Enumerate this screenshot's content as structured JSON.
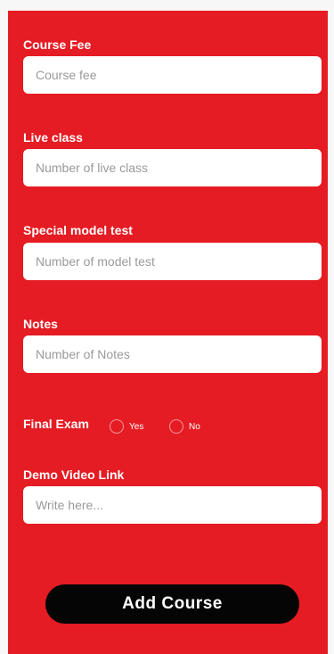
{
  "form": {
    "course_fee": {
      "label": "Course Fee",
      "placeholder": "Course fee",
      "value": ""
    },
    "live_class": {
      "label": "Live class",
      "placeholder": "Number of live class",
      "value": ""
    },
    "model_test": {
      "label": "Special model test",
      "placeholder": "Number of model test",
      "value": ""
    },
    "notes": {
      "label": "Notes",
      "placeholder": "Number of Notes",
      "value": ""
    },
    "final_exam": {
      "label": "Final Exam",
      "options": [
        "Yes",
        "No"
      ],
      "selected": null
    },
    "demo_video": {
      "label": "Demo Video Link",
      "placeholder": "Write here...",
      "value": ""
    },
    "submit_label": "Add Course"
  },
  "colors": {
    "panel_background": "#e51c23",
    "page_background": "#f7f7f7",
    "button_background": "#050505",
    "field_background": "#ffffff"
  }
}
